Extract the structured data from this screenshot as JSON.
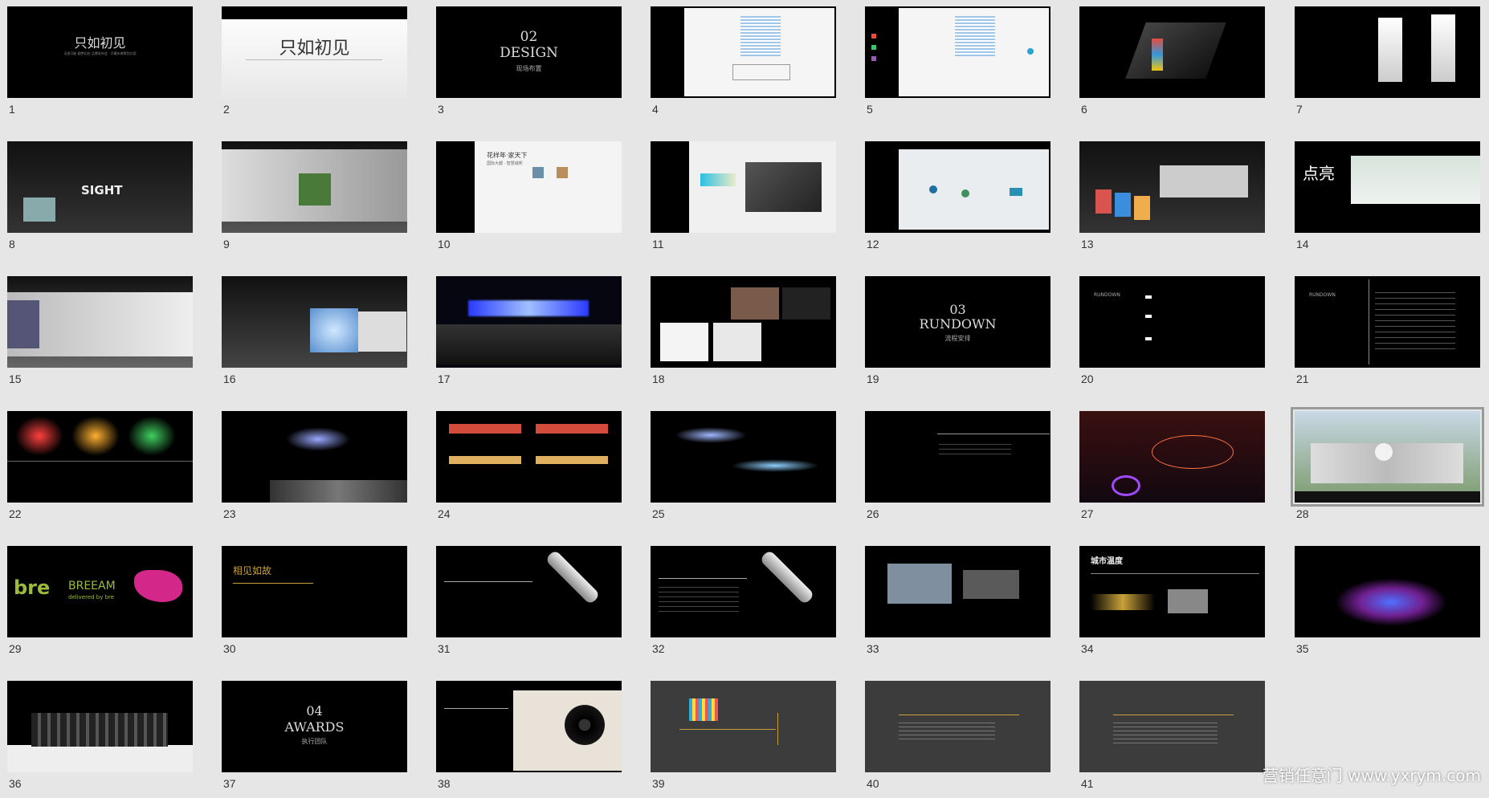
{
  "slides": [
    {
      "n": "1",
      "text": "只如初见",
      "sub": "无限可能 圆梦初启 品牌发布会 · 开幕庆典策划方案"
    },
    {
      "n": "2",
      "text": "只如初见",
      "sub": ""
    },
    {
      "n": "3",
      "text": "DESIGN",
      "sub": "现场布置",
      "num": "02"
    },
    {
      "n": "4",
      "text": "",
      "sub": ""
    },
    {
      "n": "5",
      "text": "",
      "sub": ""
    },
    {
      "n": "6",
      "text": "",
      "sub": ""
    },
    {
      "n": "7",
      "text": "",
      "sub": ""
    },
    {
      "n": "8",
      "text": "SIGHT",
      "sub": ""
    },
    {
      "n": "9",
      "text": "",
      "sub": ""
    },
    {
      "n": "10",
      "text": "花样年·家天下",
      "sub": "国际大都 · 智慧城邦"
    },
    {
      "n": "11",
      "text": "",
      "sub": ""
    },
    {
      "n": "12",
      "text": "",
      "sub": ""
    },
    {
      "n": "13",
      "text": "",
      "sub": ""
    },
    {
      "n": "14",
      "text": "点亮",
      "sub": ""
    },
    {
      "n": "15",
      "text": "",
      "sub": ""
    },
    {
      "n": "16",
      "text": "",
      "sub": ""
    },
    {
      "n": "17",
      "text": "",
      "sub": ""
    },
    {
      "n": "18",
      "text": "",
      "sub": ""
    },
    {
      "n": "19",
      "text": "RUNDOWN",
      "sub": "流程安排",
      "num": "03"
    },
    {
      "n": "20",
      "text": "RUNDOWN",
      "sub": ""
    },
    {
      "n": "21",
      "text": "RUNDOWN",
      "sub": ""
    },
    {
      "n": "22",
      "text": "",
      "sub": ""
    },
    {
      "n": "23",
      "text": "",
      "sub": ""
    },
    {
      "n": "24",
      "text": "",
      "sub": ""
    },
    {
      "n": "25",
      "text": "",
      "sub": ""
    },
    {
      "n": "26",
      "text": "",
      "sub": ""
    },
    {
      "n": "27",
      "text": "",
      "sub": ""
    },
    {
      "n": "28",
      "text": "",
      "sub": ""
    },
    {
      "n": "29",
      "text": "bre",
      "sub": "BREEAM",
      "sub2": "delivered by bre"
    },
    {
      "n": "30",
      "text": "相见如故",
      "sub": ""
    },
    {
      "n": "31",
      "text": "",
      "sub": ""
    },
    {
      "n": "32",
      "text": "",
      "sub": ""
    },
    {
      "n": "33",
      "text": "",
      "sub": ""
    },
    {
      "n": "34",
      "text": "城市温度",
      "sub": ""
    },
    {
      "n": "35",
      "text": "",
      "sub": ""
    },
    {
      "n": "36",
      "text": "",
      "sub": ""
    },
    {
      "n": "37",
      "text": "AWARDS",
      "sub": "执行团队",
      "num": "04"
    },
    {
      "n": "38",
      "text": "",
      "sub": ""
    },
    {
      "n": "39",
      "text": "",
      "sub": ""
    },
    {
      "n": "40",
      "text": "",
      "sub": ""
    },
    {
      "n": "41",
      "text": "",
      "sub": ""
    }
  ],
  "watermark": "营销任意门 www.yxrym.com",
  "colors": {
    "background": "#e6e6e6",
    "slide_dark": "#000000",
    "slide_gray": "#3c3c3c",
    "accent_gold": "#c8a13a",
    "selected_outline": "#9a9a9a"
  },
  "selected_slide": "28"
}
